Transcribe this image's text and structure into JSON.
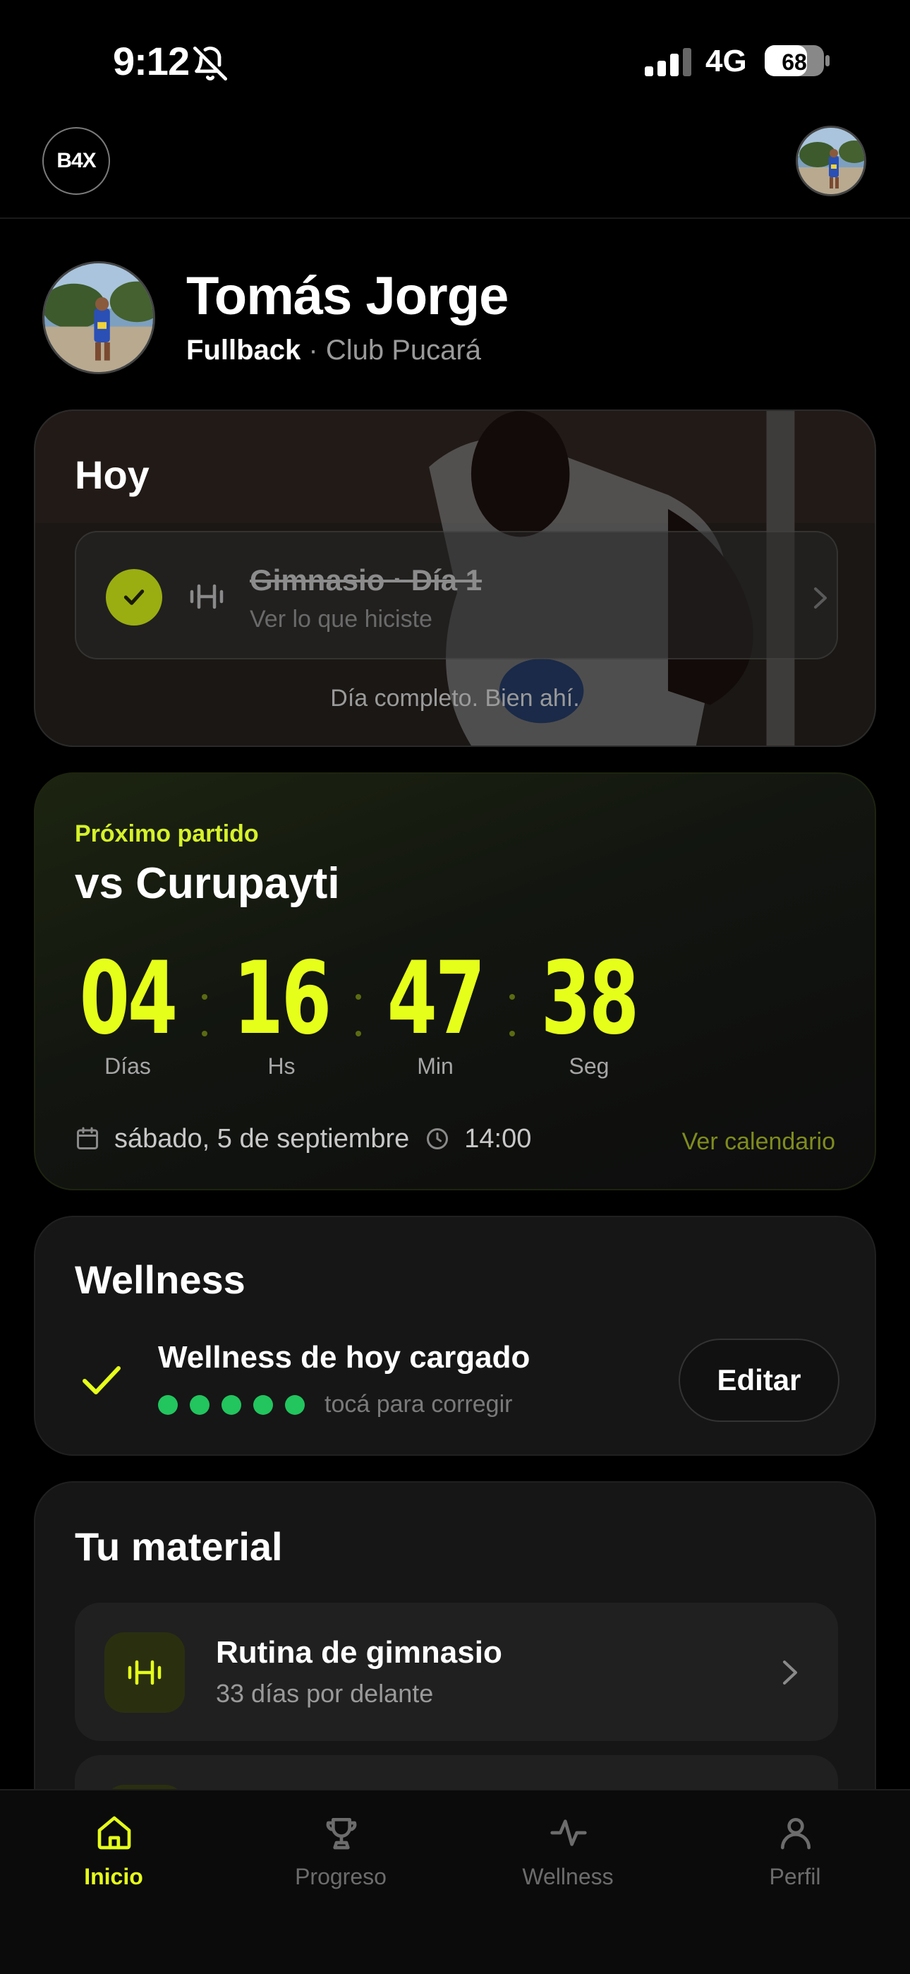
{
  "status_bar": {
    "time": "9:12",
    "network": "4G",
    "battery": "68"
  },
  "header": {
    "logo_text": "B4X"
  },
  "profile": {
    "name": "Tomás Jorge",
    "position": "Fullback",
    "separator": "·",
    "club": "Club Pucará"
  },
  "today": {
    "title": "Hoy",
    "task": {
      "title": "Gimnasio · Día 1",
      "subtitle": "Ver lo que hiciste",
      "completed": true
    },
    "footer": "Día completo. Bien ahí."
  },
  "next_match": {
    "label": "Próximo partido",
    "title": "vs Curupayti",
    "countdown": [
      {
        "value": "04",
        "unit": "Días"
      },
      {
        "value": "16",
        "unit": "Hs"
      },
      {
        "value": "47",
        "unit": "Min"
      },
      {
        "value": "38",
        "unit": "Seg"
      }
    ],
    "date": "sábado, 5 de septiembre",
    "time": "14:00",
    "calendar_link": "Ver calendario"
  },
  "wellness": {
    "title": "Wellness",
    "status": "Wellness de hoy cargado",
    "rating_filled": 5,
    "rating_total": 5,
    "hint": "tocá para corregir",
    "edit_label": "Editar"
  },
  "material": {
    "title": "Tu material",
    "items": [
      {
        "name": "Rutina de gimnasio",
        "subtitle": "33 días por delante",
        "icon": "dumbbell-icon"
      }
    ]
  },
  "tabs": [
    {
      "label": "Inicio",
      "icon": "home-icon",
      "active": true
    },
    {
      "label": "Progreso",
      "icon": "trophy-icon",
      "active": false
    },
    {
      "label": "Wellness",
      "icon": "activity-icon",
      "active": false
    },
    {
      "label": "Perfil",
      "icon": "user-icon",
      "active": false
    }
  ],
  "colors": {
    "accent": "#E6FF1A",
    "success": "#22C55E",
    "background": "#000000",
    "card": "#161616"
  }
}
